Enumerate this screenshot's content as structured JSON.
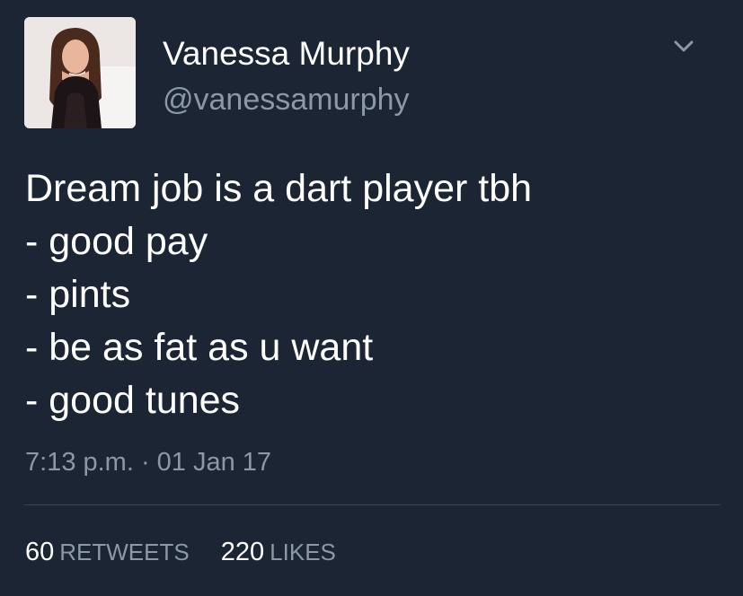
{
  "user": {
    "display_name": "Vanessa Murphy",
    "handle": "@vanessamurphy"
  },
  "tweet": {
    "lines": [
      "Dream job is a dart player tbh",
      "- good pay",
      "- pints",
      "- be as fat as u want",
      "- good tunes"
    ],
    "timestamp": "7:13 p.m. · 01 Jan 17"
  },
  "stats": {
    "retweets_count": "60",
    "retweets_label": "RETWEETS",
    "likes_count": "220",
    "likes_label": "LIKES"
  },
  "icons": {
    "more_options": "chevron-down-icon"
  },
  "colors": {
    "background": "#1b2533",
    "primary_text": "#ffffff",
    "secondary_text": "#8b98a6",
    "divider": "#3a4656"
  }
}
